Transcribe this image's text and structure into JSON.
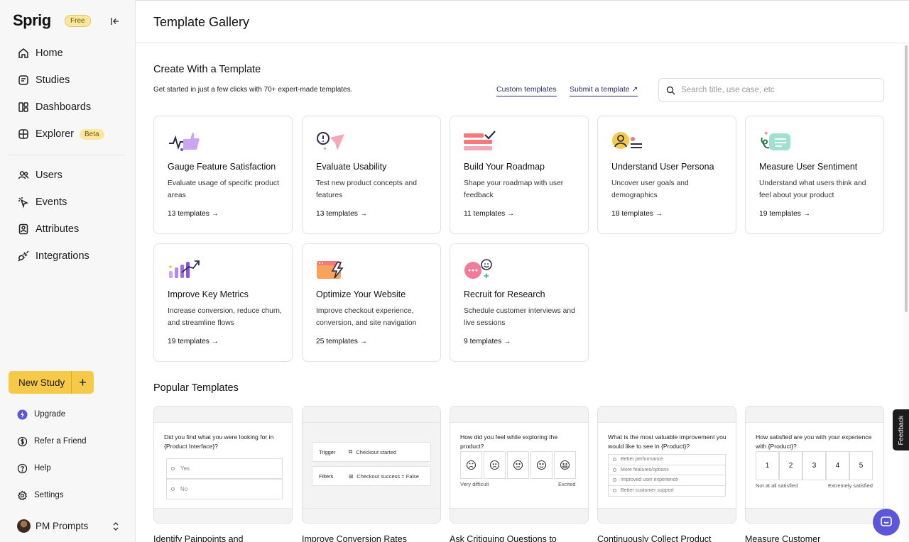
{
  "app": {
    "logo": "Sprig",
    "plan_badge": "Free"
  },
  "nav": [
    {
      "label": "Home",
      "icon": "home-icon"
    },
    {
      "label": "Studies",
      "icon": "studies-icon"
    },
    {
      "label": "Dashboards",
      "icon": "dashboards-icon"
    },
    {
      "label": "Explorer",
      "icon": "explorer-icon",
      "badge": "Beta"
    },
    {
      "label": "Users",
      "icon": "users-icon"
    },
    {
      "label": "Events",
      "icon": "events-icon"
    },
    {
      "label": "Attributes",
      "icon": "attributes-icon"
    },
    {
      "label": "Integrations",
      "icon": "integrations-icon"
    }
  ],
  "new_study": {
    "label": "New Study",
    "plus": "+"
  },
  "bottom_nav": [
    {
      "label": "Upgrade",
      "icon": "lightning-icon"
    },
    {
      "label": "Refer a Friend",
      "icon": "dollar-icon"
    },
    {
      "label": "Help",
      "icon": "help-icon"
    },
    {
      "label": "Settings",
      "icon": "gear-icon"
    }
  ],
  "profile": {
    "name": "PM Prompts"
  },
  "header": {
    "title": "Template Gallery"
  },
  "create": {
    "title": "Create With a Template",
    "subtitle": "Get started in just a few clicks with 70+ expert-made templates.",
    "custom_link": "Custom templates",
    "submit_link": "Submit a template ↗",
    "search_placeholder": "Search title, use case, etc"
  },
  "categories": [
    {
      "title": "Gauge Feature Satisfaction",
      "desc": "Evaluate usage of specific product areas",
      "count": "13 templates →"
    },
    {
      "title": "Evaluate Usability",
      "desc": "Test new product concepts and features",
      "count": "13 templates →"
    },
    {
      "title": "Build Your Roadmap",
      "desc": "Shape your roadmap with user feedback",
      "count": "11 templates →"
    },
    {
      "title": "Understand User Persona",
      "desc": "Uncover user goals and demographics",
      "count": "18 templates →"
    },
    {
      "title": "Measure User Sentiment",
      "desc": "Understand what users think and feel about your product",
      "count": "19 templates →"
    },
    {
      "title": "Improve Key Metrics",
      "desc": "Increase conversion, reduce churn, and streamline flows",
      "count": "19 templates →"
    },
    {
      "title": "Optimize Your Website",
      "desc": "Improve checkout experience, conversion, and site navigation",
      "count": "25 templates →"
    },
    {
      "title": "Recruit for Research",
      "desc": "Schedule customer interviews and live sessions",
      "count": "9 templates →"
    }
  ],
  "popular": {
    "title": "Popular Templates",
    "cards": [
      {
        "question": "Did you find what you were looking for in {Product Interface}?",
        "options": [
          "Yes",
          "No"
        ],
        "title": "Identify Painpoints and"
      },
      {
        "rows": [
          {
            "key": "Trigger",
            "value": "Checkout started"
          },
          {
            "key": "Filters",
            "value": "Checkout success = False"
          }
        ],
        "title": "Improve Conversion Rates"
      },
      {
        "question": "How did you feel while exploring the product?",
        "low": "Very difficult",
        "high": "Excited",
        "title": "Ask Critiquing Questions to"
      },
      {
        "question": "What is the most valuable improvement you would like to see in {Product}?",
        "options": [
          "Better performance",
          "More features/options",
          "Improved user experience",
          "Better customer support"
        ],
        "title": "Continuously Collect Product"
      },
      {
        "question": "How satisfied are you with your experience with {Product}?",
        "scale": [
          "1",
          "2",
          "3",
          "4",
          "5"
        ],
        "low": "Not at all satisfied",
        "high": "Extremely satisfied",
        "title": "Measure Customer"
      }
    ]
  },
  "feedback_tab": "Feedback",
  "colors": {
    "accent": "#f7c948",
    "chat": "#5b57d8",
    "link": "#2a2a6e"
  }
}
